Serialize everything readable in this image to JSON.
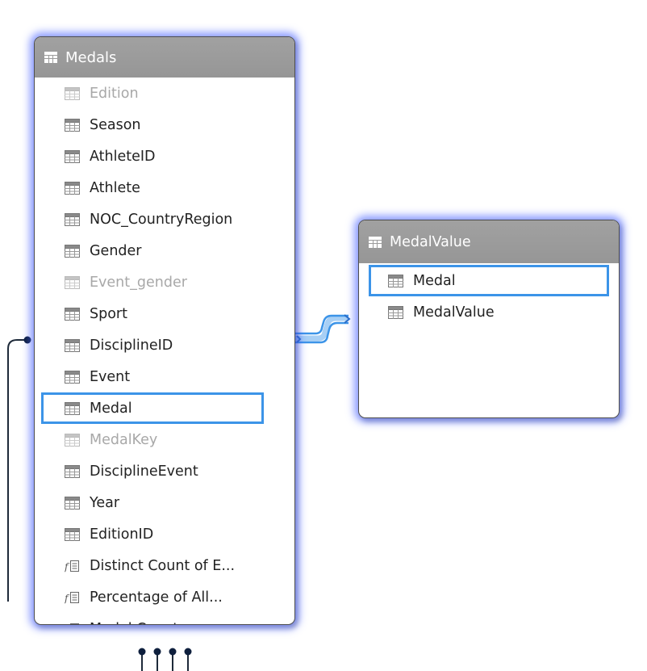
{
  "medals_table": {
    "title": "Medals",
    "columns": [
      {
        "label": "Edition",
        "kind": "column",
        "hidden": true,
        "selected": false
      },
      {
        "label": "Season",
        "kind": "column",
        "hidden": false,
        "selected": false
      },
      {
        "label": "AthleteID",
        "kind": "column",
        "hidden": false,
        "selected": false
      },
      {
        "label": "Athlete",
        "kind": "column",
        "hidden": false,
        "selected": false
      },
      {
        "label": "NOC_CountryRegion",
        "kind": "column",
        "hidden": false,
        "selected": false
      },
      {
        "label": "Gender",
        "kind": "column",
        "hidden": false,
        "selected": false
      },
      {
        "label": "Event_gender",
        "kind": "column",
        "hidden": true,
        "selected": false
      },
      {
        "label": "Sport",
        "kind": "column",
        "hidden": false,
        "selected": false
      },
      {
        "label": "DisciplineID",
        "kind": "column",
        "hidden": false,
        "selected": false
      },
      {
        "label": "Event",
        "kind": "column",
        "hidden": false,
        "selected": false
      },
      {
        "label": "Medal",
        "kind": "column",
        "hidden": false,
        "selected": true
      },
      {
        "label": "MedalKey",
        "kind": "column",
        "hidden": true,
        "selected": false
      },
      {
        "label": "DisciplineEvent",
        "kind": "column",
        "hidden": false,
        "selected": false
      },
      {
        "label": "Year",
        "kind": "column",
        "hidden": false,
        "selected": false
      },
      {
        "label": "EditionID",
        "kind": "column",
        "hidden": false,
        "selected": false
      },
      {
        "label": "Distinct Count of E...",
        "kind": "measure",
        "hidden": false,
        "selected": false
      },
      {
        "label": "Percentage of All...",
        "kind": "measure",
        "hidden": false,
        "selected": false
      },
      {
        "label": "Medal Count",
        "kind": "measure",
        "hidden": false,
        "selected": false
      }
    ]
  },
  "medalvalue_table": {
    "title": "MedalValue",
    "columns": [
      {
        "label": "Medal",
        "kind": "column",
        "hidden": false,
        "selected": true
      },
      {
        "label": "MedalValue",
        "kind": "column",
        "hidden": false,
        "selected": false
      }
    ]
  },
  "icons": {
    "table": "table-grid-icon",
    "column": "column-grid-icon",
    "measure": "calculated-measure-icon",
    "scroll_up": "chevron-up-icon",
    "scroll_down": "chevron-down-icon"
  },
  "colors": {
    "header_bg": "#9c9c9c",
    "selection_border": "#3c94e8",
    "glow": "#465fff",
    "relationship_line": "#3c94e8",
    "connector_line": "#1e2a3a"
  }
}
